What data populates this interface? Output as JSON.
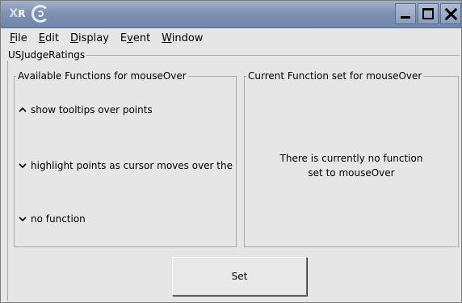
{
  "window": {
    "title_logo": "R",
    "title_logo_mark": "X"
  },
  "menubar": {
    "items": [
      {
        "key": "F",
        "rest": "ile"
      },
      {
        "key": "E",
        "rest": "dit"
      },
      {
        "key": "D",
        "rest": "isplay"
      },
      {
        "pre": "E",
        "key": "v",
        "rest": "ent"
      },
      {
        "key": "W",
        "rest": "indow"
      }
    ]
  },
  "outer_group": {
    "label": "USJudgeRatings"
  },
  "available": {
    "label": "Available Functions for mouseOver",
    "options": [
      {
        "icon": "chevron-up-icon",
        "label": "show tooltips over points"
      },
      {
        "icon": "chevron-down-icon",
        "label": "highlight points as cursor moves over the"
      },
      {
        "icon": "chevron-down-icon",
        "label": "no function"
      }
    ]
  },
  "current": {
    "label": "Current Function set for mouseOver",
    "message_line1": "There is currently no function",
    "message_line2": "set to mouseOver"
  },
  "set_button": {
    "label": "Set"
  },
  "colors": {
    "titlebar": "#7e93b3",
    "background": "#e6e6e6"
  }
}
